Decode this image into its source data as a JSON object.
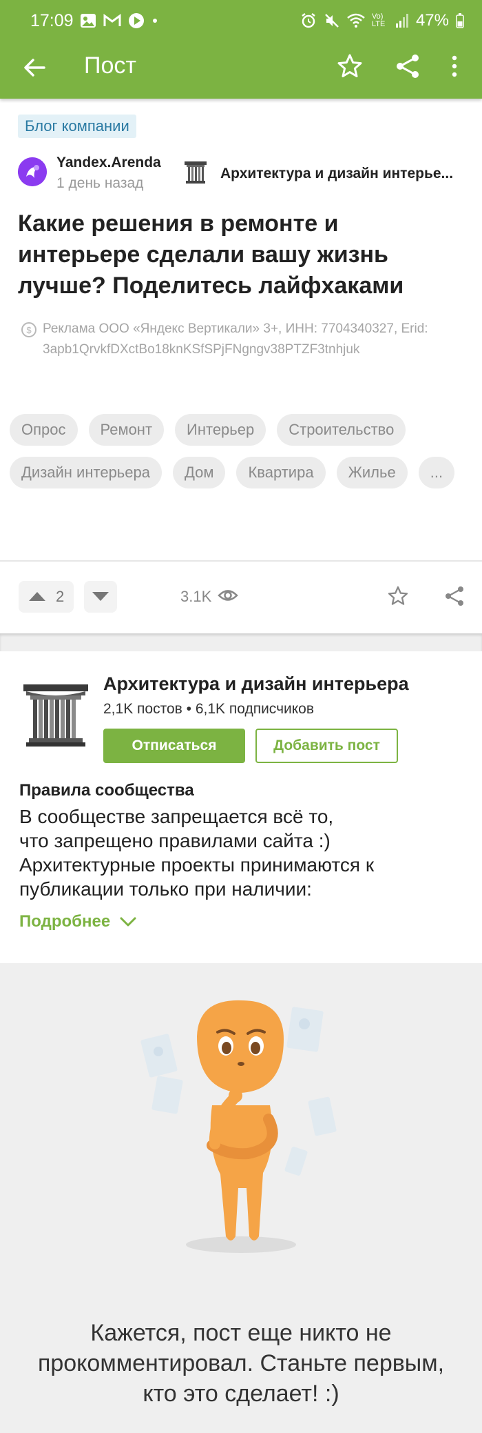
{
  "status_bar": {
    "time": "17:09",
    "battery": "47%",
    "network": "Vo) LTE"
  },
  "app_bar": {
    "title": "Пост"
  },
  "post": {
    "badge": "Блог компании",
    "author": "Yandex.Arenda",
    "date": "1 день назад",
    "community": "Архитектура и дизайн интерье...",
    "title": "Какие решения в ремонте и интерьере сделали вашу жизнь лучше? Поделитесь лайфхаками",
    "ad_line1": "Реклама ООО «Яндекс Вертикали» 3+, ИНН: 7704340327, Erid:",
    "ad_line2": "3apb1QrvkfDXctBo18knKSfSPjFNgngv38PTZF3tnhjuk",
    "tags": [
      "Опрос",
      "Ремонт",
      "Интерьер",
      "Строительство",
      "Дизайн интерьера",
      "Дом",
      "Квартира",
      "Жилье",
      "..."
    ],
    "votes": "2",
    "views": "3.1K"
  },
  "community_card": {
    "name": "Архитектура и дизайн интерьера",
    "stats": "2,1K постов • 6,1K подписчиков",
    "unsubscribe_label": "Отписаться",
    "add_post_label": "Добавить пост",
    "rules_title": "Правила сообщества",
    "rules_line1": "В сообществе запрещается всё то,",
    "rules_line2": "что запрещено правилами сайта :)",
    "rules_line3": "Архитектурные проекты принимаются к",
    "rules_line4": "публикации только при наличии:",
    "more_label": "Подробнее"
  },
  "empty_state": {
    "line1": "Кажется, пост еще никто не",
    "line2": "прокомментировал. Станьте первым,",
    "line3": "кто это сделает! :)"
  },
  "colors": {
    "accent": "#7cb342",
    "badge_bg": "#e3f1f7",
    "badge_text": "#2a7aa3",
    "avatar": "#8b3bf0",
    "figure": "#f5a447"
  }
}
